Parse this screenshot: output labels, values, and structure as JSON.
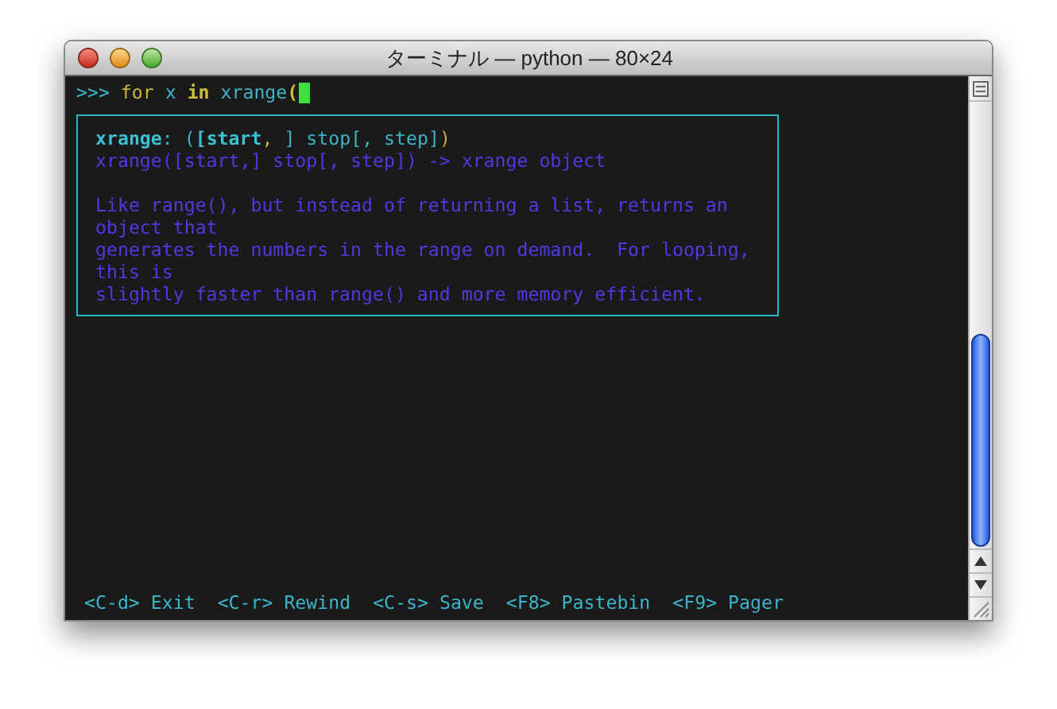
{
  "window": {
    "title": "ターミナル — python — 80×24"
  },
  "prompt": [
    {
      "kind": "prompt",
      "text": ">>> "
    },
    {
      "kind": "keyword",
      "text": "for "
    },
    {
      "kind": "name",
      "text": "x "
    },
    {
      "kind": "strong_keyword",
      "text": "in "
    },
    {
      "kind": "name",
      "text": "xrange"
    },
    {
      "kind": "strong_paren",
      "text": "("
    }
  ],
  "signature": [
    {
      "kind": "strong_name",
      "text": "xrange"
    },
    {
      "kind": "name",
      "text": ": ("
    },
    {
      "kind": "strong_name",
      "text": "[start"
    },
    {
      "kind": "punct",
      "text": ", "
    },
    {
      "kind": "name",
      "text": "] stop[, step]"
    },
    {
      "kind": "punct",
      "text": ")"
    }
  ],
  "doc": [
    [
      "xrange([start,] stop[, step]) -> xrange object"
    ],
    [
      "Like range(), but instead of returning a list, returns an",
      "object that",
      "generates the numbers in the range on demand.  For looping,",
      "this is",
      "slightly faster than range() and more memory efficient."
    ]
  ],
  "footer": [
    "<C-d> Exit",
    "<C-r> Rewind",
    "<C-s> Save",
    "<F8> Pastebin",
    "<F9> Pager"
  ]
}
